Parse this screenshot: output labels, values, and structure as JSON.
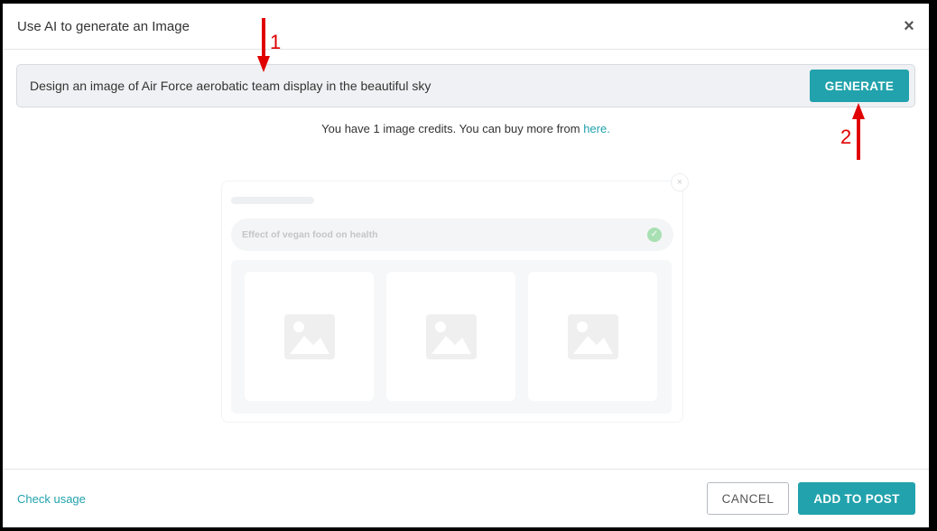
{
  "dialog": {
    "title": "Use AI to generate an Image",
    "close_glyph": "×"
  },
  "prompt": {
    "value": "Design an image of Air Force aerobatic team display in the beautiful sky",
    "generate_label": "GENERATE"
  },
  "credits": {
    "text": "You have 1 image credits. You can buy more from ",
    "link_label": "here."
  },
  "illustration": {
    "close_glyph": "×",
    "prompt_text": "Effect of vegan food on health",
    "check_glyph": "✓",
    "placeholder_icons": [
      "image-icon",
      "image-icon",
      "image-icon"
    ]
  },
  "footer": {
    "check_usage_label": "Check usage",
    "cancel_label": "CANCEL",
    "add_label": "ADD TO POST"
  },
  "annotations": {
    "marker_1": "1",
    "marker_2": "2",
    "color": "#e00000"
  },
  "colors": {
    "accent": "#21a2ac",
    "success": "#a8e0b3"
  }
}
